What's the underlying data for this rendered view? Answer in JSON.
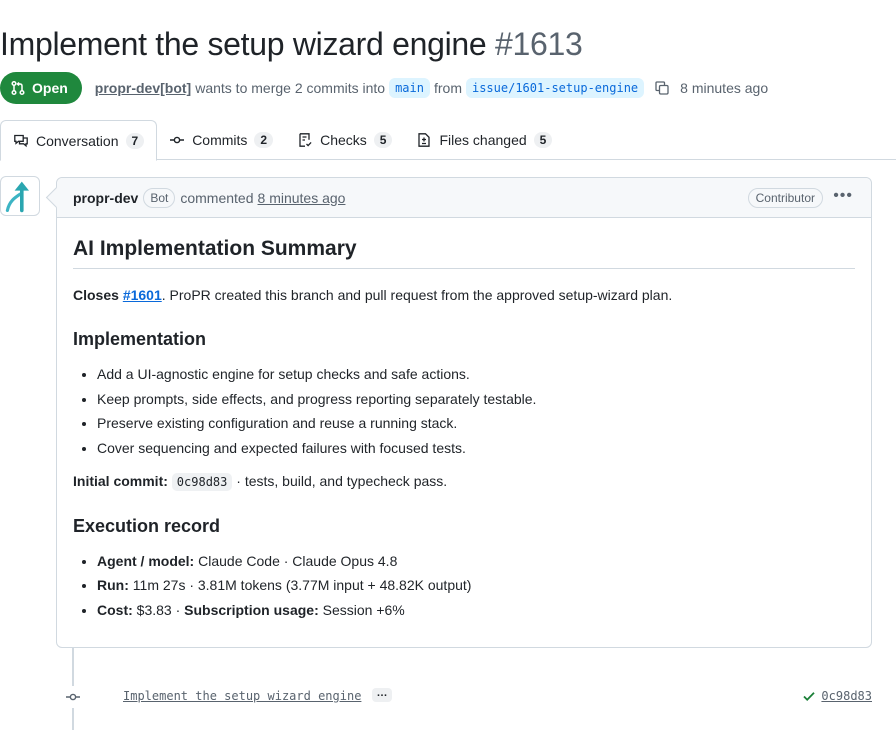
{
  "pr": {
    "title": "Implement the setup wizard engine",
    "number": "#1613",
    "state": "Open",
    "author": "propr-dev[bot]",
    "merge_text": "wants to merge 2 commits into",
    "base_branch": "main",
    "from_text": "from",
    "head_branch": "issue/1601-setup-engine",
    "time": "8 minutes ago"
  },
  "tabs": [
    {
      "label": "Conversation",
      "count": "7"
    },
    {
      "label": "Commits",
      "count": "2"
    },
    {
      "label": "Checks",
      "count": "5"
    },
    {
      "label": "Files changed",
      "count": "5"
    }
  ],
  "comment": {
    "author": "propr-dev",
    "bot_label": "Bot",
    "action": "commented",
    "time": "8 minutes ago",
    "role": "Contributor",
    "heading": "AI Implementation Summary",
    "closes_label": "Closes",
    "closes_issue": "#1601",
    "closes_rest": ". ProPR created this branch and pull request from the approved setup-wizard plan.",
    "impl_heading": "Implementation",
    "impl_items": [
      "Add a UI-agnostic engine for setup checks and safe actions.",
      "Keep prompts, side effects, and progress reporting separately testable.",
      "Preserve existing configuration and reuse a running stack.",
      "Cover sequencing and expected failures with focused tests."
    ],
    "initial_label": "Initial commit:",
    "initial_sha": "0c98d83",
    "initial_rest": "· tests, build, and typecheck pass.",
    "exec_heading": "Execution record",
    "exec_items": [
      {
        "label": "Agent / model:",
        "value": "Claude Code · Claude Opus 4.8"
      },
      {
        "label": "Run:",
        "value": "11m 27s · 3.81M tokens (3.77M input + 48.82K output)"
      },
      {
        "label": "Cost:",
        "value": "$3.83 · ",
        "label2": "Subscription usage:",
        "value2": "Session +6%"
      }
    ]
  },
  "commit": {
    "message": "Implement the setup wizard engine",
    "ellipsis": "…",
    "sha": "0c98d83"
  },
  "colors": {
    "open_green": "#1f883d",
    "link_blue": "#0969da",
    "muted": "#59636e",
    "border": "#d1d9e0"
  }
}
